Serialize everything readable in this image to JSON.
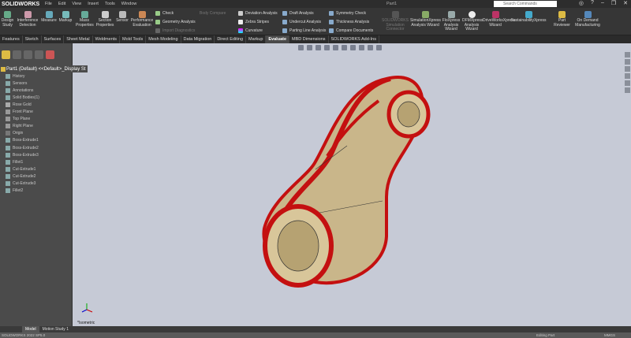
{
  "app": {
    "name": "SOLIDWORKS",
    "document": "Part1",
    "search_placeholder": "Search Commands"
  },
  "menu": [
    "File",
    "Edit",
    "View",
    "Insert",
    "Tools",
    "Window"
  ],
  "ribbon": {
    "buttons": [
      {
        "label": "Design Study"
      },
      {
        "label": "Interference Detection"
      },
      {
        "label": "Measure"
      },
      {
        "label": "Markup"
      },
      {
        "label": "Mass Properties"
      },
      {
        "label": "Section Properties"
      },
      {
        "label": "Sensor"
      },
      {
        "label": "Performance Evaluation"
      }
    ],
    "list1": [
      "Check",
      "Geometry Analysis",
      "Import Diagnostics"
    ],
    "body_compare": "Body Compare",
    "list2": [
      "Deviation Analysis",
      "Zebra Stripes",
      "Curvature"
    ],
    "list3": [
      "Draft Analysis",
      "Undercut Analysis",
      "Parting Line Analysis"
    ],
    "list4": [
      "Symmetry Check",
      "Thickness Analysis",
      "Compare Documents"
    ],
    "buttons2": [
      {
        "label": "SOLIDWORKS Simulation Connector"
      },
      {
        "label": "SimulationXpress Analysis Wizard"
      },
      {
        "label": "FloXpress Analysis Wizard"
      },
      {
        "label": "DFMXpress Analysis Wizard"
      },
      {
        "label": "DriveWorksXpress Wizard"
      },
      {
        "label": "SustainabilityXpress"
      },
      {
        "label": "Part Reviewer"
      },
      {
        "label": "On Demand Manufacturing"
      }
    ]
  },
  "tabs": [
    "Features",
    "Sketch",
    "Surfaces",
    "Sheet Metal",
    "Weldments",
    "Mold Tools",
    "Mesh Modeling",
    "Data Migration",
    "Direct Editing",
    "Markup",
    "Evaluate",
    "MBD Dimensions",
    "SOLIDWORKS Add-Ins"
  ],
  "active_tab": "Evaluate",
  "tree": {
    "root": "Part1 (Default) <<Default>_Display St",
    "items": [
      "History",
      "Sensors",
      "Annotations",
      "Solid Bodies(1)",
      "Rose Gold",
      "Front Plane",
      "Top Plane",
      "Right Plane",
      "Origin",
      "Boss-Extrude1",
      "Boss-Extrude2",
      "Boss-Extrude3",
      "Fillet1",
      "Cut-Extrude1",
      "Cut-Extrude2",
      "Cut-Extrude3",
      "Fillet2"
    ]
  },
  "viewport": {
    "view_label": "*Isometric"
  },
  "bottom_tabs": [
    "Model",
    "Motion Study 1"
  ],
  "status": {
    "left": "SOLIDWORKS 2022 SP5.0",
    "editing": "Editing Part",
    "units": "MMGS"
  }
}
